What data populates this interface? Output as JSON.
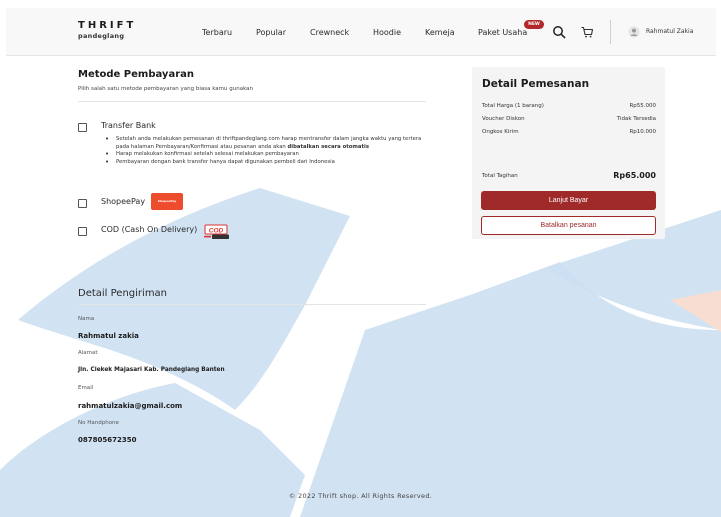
{
  "header": {
    "logo": {
      "main": "THRIFT",
      "sub": "pandeglang"
    },
    "nav": [
      {
        "label": "Terbaru"
      },
      {
        "label": "Popular"
      },
      {
        "label": "Crewneck"
      },
      {
        "label": "Hoodie"
      },
      {
        "label": "Kemeja"
      },
      {
        "label": "Paket Usaha"
      }
    ],
    "new_badge": "NEW",
    "icons": {
      "search": "search-icon",
      "cart": "cart-icon",
      "user": "user-icon"
    },
    "user_name": "Rahmatul Zakia"
  },
  "payment": {
    "title": "Metode Pembayaran",
    "subtitle": "Pilih salah satu metode pembayaran yang biasa kamu gunakan",
    "options": [
      {
        "label": "Transfer Bank",
        "checked": false
      },
      {
        "label": "ShopeePay",
        "checked": false,
        "logo_text": "ShopeePay"
      },
      {
        "label": "COD (Cash On Delivery)",
        "checked": false,
        "logo_text": "COD"
      }
    ],
    "bank_notes": {
      "line1": "Setelah anda melakukan pemesanan di thriftpandeglang.com harap mentransfer dalam jangka waktu yang tertera pada halaman Pembayaran/Konfirmasi atau pesanan anda akan ",
      "line1_bold": "dibatalkan secara otomatis",
      "line2": "Harap melakukan konfirmasi setelah selesai melakukan pembayaran",
      "line3": "Pembayaran dengan bank transfer hanya dapat digunakan pembeli dari Indonesia"
    }
  },
  "summary": {
    "title": "Detail Pemesanan",
    "rows": [
      {
        "label": "Total Harga (1 barang)",
        "value": "Rp55.000"
      },
      {
        "label": "Voucher Diskon",
        "value": "Tidak Tersedia"
      },
      {
        "label": "Ongkos Kirim",
        "value": "Rp10.000"
      }
    ],
    "total_label": "Total Tagihan",
    "total_value": "Rp65.000",
    "pay_button": "Lanjut Bayar",
    "cancel_button": "Batalkan pesanan"
  },
  "shipping": {
    "title": "Detail Pengiriman",
    "fields": [
      {
        "label": "Nama",
        "value": "Rahmatul zakia"
      },
      {
        "label": "Alamat",
        "value": "Jln. Ciekek Majasari Kab. Pandeglang Banten"
      },
      {
        "label": "Email",
        "value": "rahmatulzakia@gmail.com"
      },
      {
        "label": "No Handphone",
        "value": "087805672350"
      }
    ]
  },
  "footer": "© 2022 Thrift shop. All Rights Reserved.",
  "colors": {
    "accent": "#a02a2a",
    "badge": "#b3262c",
    "shopeepay": "#ee4d2d",
    "watermark_blue": "#1b6fc2",
    "watermark_orange": "#f26522"
  }
}
